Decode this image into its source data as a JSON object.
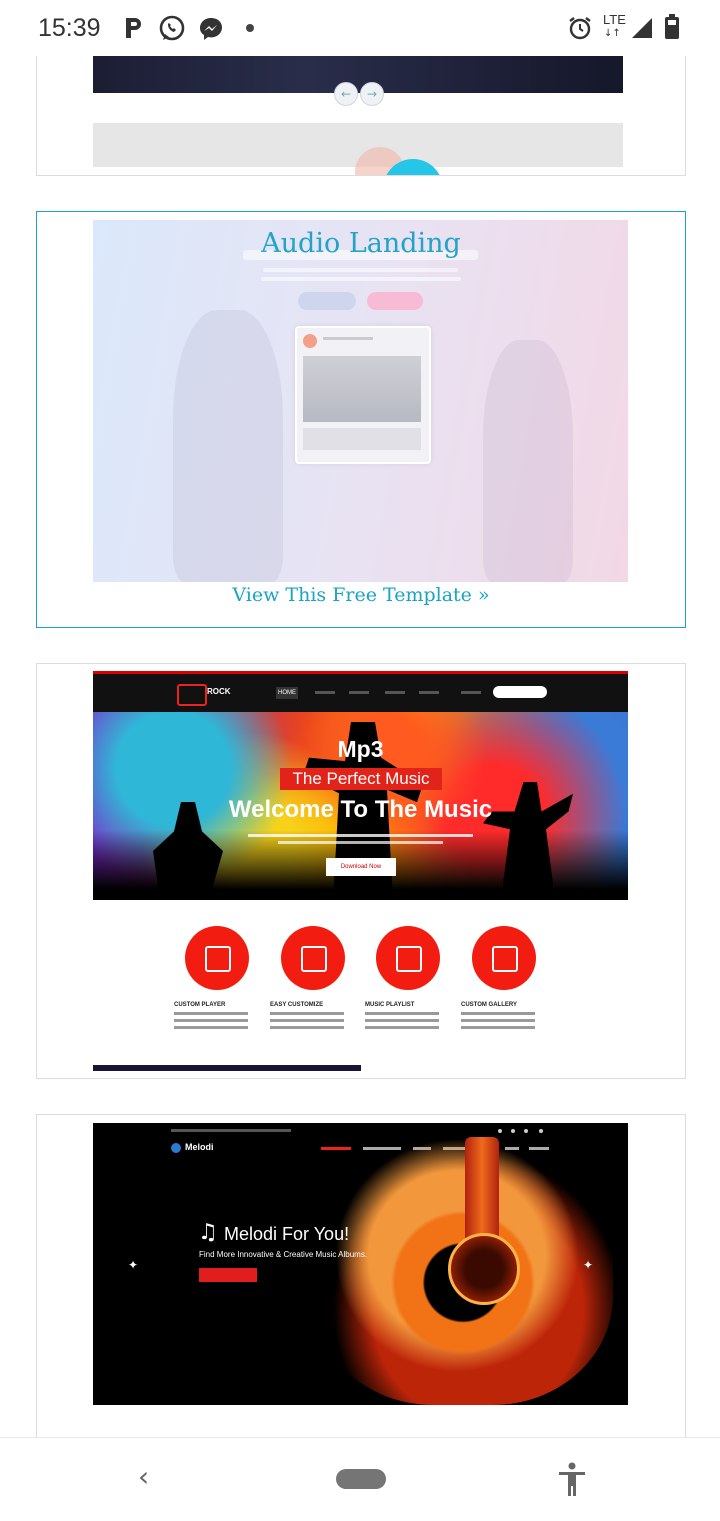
{
  "status_bar": {
    "time": "15:39",
    "left_icons": [
      "parking-icon",
      "whatsapp-icon",
      "messenger-icon",
      "dot-icon"
    ],
    "network_label": "LTE",
    "right_icons": [
      "alarm-icon",
      "lte-icon",
      "signal-icon",
      "battery-icon"
    ]
  },
  "templates": [
    {
      "name": "",
      "link": "",
      "partial": true
    },
    {
      "name": "Audio Landing",
      "link": "View This Free Template »",
      "selected": true
    },
    {
      "name": "Mp3",
      "preview": {
        "logo": "ROCK",
        "nav_active": "HOME",
        "headline_1": "Mp3",
        "headline_2": "The Perfect Music",
        "headline_3": "Welcome To The Music",
        "button": "Download Now",
        "features": [
          "CUSTOM PLAYER",
          "EASY CUSTOMIZE",
          "MUSIC PLAYLIST",
          "CUSTOM GALLERY"
        ]
      }
    },
    {
      "name": "Melodi",
      "preview": {
        "logo": "Melodi",
        "headline": "Melodi For You!",
        "subline": "Find More Innovative & Creative Music Albums."
      }
    }
  ],
  "nav_bar": {
    "back": "‹",
    "accessibility": "🚶"
  }
}
